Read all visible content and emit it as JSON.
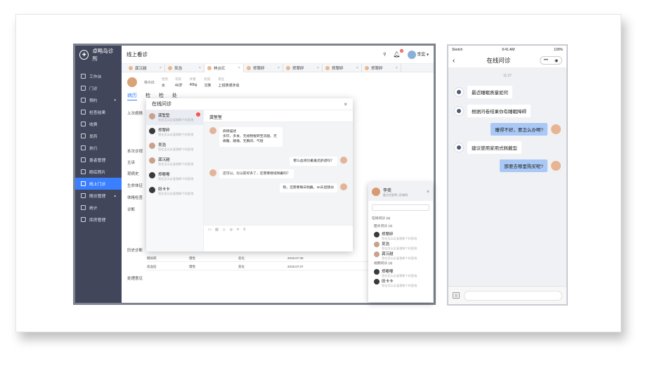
{
  "app": {
    "brand": "卓略岛诊所",
    "page_title": "线上看诊"
  },
  "sidebar": {
    "items": [
      {
        "label": "工作台"
      },
      {
        "label": "门诊"
      },
      {
        "label": "预约"
      },
      {
        "label": "检查结果"
      },
      {
        "label": "收费"
      },
      {
        "label": "发药"
      },
      {
        "label": "执行"
      },
      {
        "label": "患者管理"
      },
      {
        "label": "眼底照片"
      },
      {
        "label": "线上门诊"
      },
      {
        "label": "随访管理"
      },
      {
        "label": "统计"
      },
      {
        "label": "库房管理"
      }
    ]
  },
  "topbar": {
    "bell_count": "8",
    "user": "李奕"
  },
  "patient_tabs": [
    "龚沉越",
    "吴浩",
    "林炎红",
    "郑翠碎",
    "郑翠碎",
    "郑翠碎",
    "郑翠碎"
  ],
  "patient": {
    "name": "林炎红",
    "fields": [
      {
        "k": "性别",
        "v": "女"
      },
      {
        "k": "年龄",
        "v": "40岁"
      },
      {
        "k": "体重",
        "v": "40kg"
      },
      {
        "k": "民族",
        "v": "汉族"
      },
      {
        "k": "职业",
        "v": "上班族通涉谈"
      }
    ]
  },
  "section_tabs": [
    "病历",
    "检",
    "检",
    "处"
  ],
  "labels": {
    "last_record": "上次病情",
    "this_visit": "本次诊视",
    "main_complaint": "主诉",
    "present_history": "现病史",
    "vital": "生命体征",
    "exam": "体格检查",
    "diagnosis": "诊断",
    "history_dx": "历史诊断",
    "treatment": "处理意见"
  },
  "bg_rows": [
    {
      "a": "糖尿病",
      "b": "慢性",
      "c": "恶化",
      "d": "2019.07.09"
    },
    {
      "a": "高血压",
      "b": "慢性",
      "c": "恶化",
      "d": "2019.07.07"
    }
  ],
  "modal": {
    "title": "在线问诊",
    "contacts": [
      {
        "name": "龚堑堑",
        "sub": "您在怎么反复我断个科室地"
      },
      {
        "name": "郑翠碎",
        "sub": "您在怎么反复我断个科室地"
      },
      {
        "name": "吴浩",
        "sub": "您在怎么反复我断个科室地"
      },
      {
        "name": "龚沉越",
        "sub": "您在怎么反复我断个科室地"
      },
      {
        "name": "郑嘟嘟",
        "sub": "您在怎么反复我断个科室地"
      },
      {
        "name": "田卡卡",
        "sub": "您在怎么反复我断个科室地"
      }
    ],
    "active_name": "龚堑堑",
    "messages": [
      {
        "side": "left",
        "text": "病情描述\n多饮、多食、无规物根转至双腿、无痛暖、跳痛、无胸闷、气短"
      },
      {
        "side": "right",
        "text": "那么血液仪戴着还舒适吗？"
      },
      {
        "side": "left",
        "text": "还可以，比以前好多了，还需要继续佩戴吗？"
      },
      {
        "side": "right",
        "text": "嗯，还需要每日佩戴，30天后随访"
      }
    ],
    "toolbar": "▭ ▧ ☺ ◎ ✈ ⚲"
  },
  "sidepanel": {
    "name": "李奕",
    "sub": "副主任医师 | 肝病科",
    "group1": "在线问诊 (5)",
    "group1a": "图文问诊 (2)",
    "items1": [
      {
        "name": "郑翠碎",
        "sub": "您在怎么反复我断个科室地"
      },
      {
        "name": "吴浩",
        "sub": "您在怎么反复我断个科室地"
      },
      {
        "name": "龚沉越",
        "sub": "您在怎么反复我断个科室地"
      }
    ],
    "group1b": "视频问诊 (3)",
    "items2": [
      {
        "name": "郑嘟嘟",
        "sub": "您在怎么反复我断个科室地"
      },
      {
        "name": "田卡卡",
        "sub": "您在怎么反复我断个科室地"
      }
    ]
  },
  "phone": {
    "carrier": "Sketch",
    "time": "9:41 AM",
    "battery": "100%",
    "title": "在线问诊",
    "timestamp": "11:27",
    "messages": [
      {
        "side": "left",
        "text": "最近睡眠质量如何"
      },
      {
        "side": "left",
        "text": "根据问卷结果你有睡眠障碍"
      },
      {
        "side": "right",
        "text": "睡得不好，要怎么办啊?"
      },
      {
        "side": "left",
        "text": "建议使用家用式佩戴型"
      },
      {
        "side": "right",
        "text": "那要去哪里购买呢?"
      }
    ]
  }
}
